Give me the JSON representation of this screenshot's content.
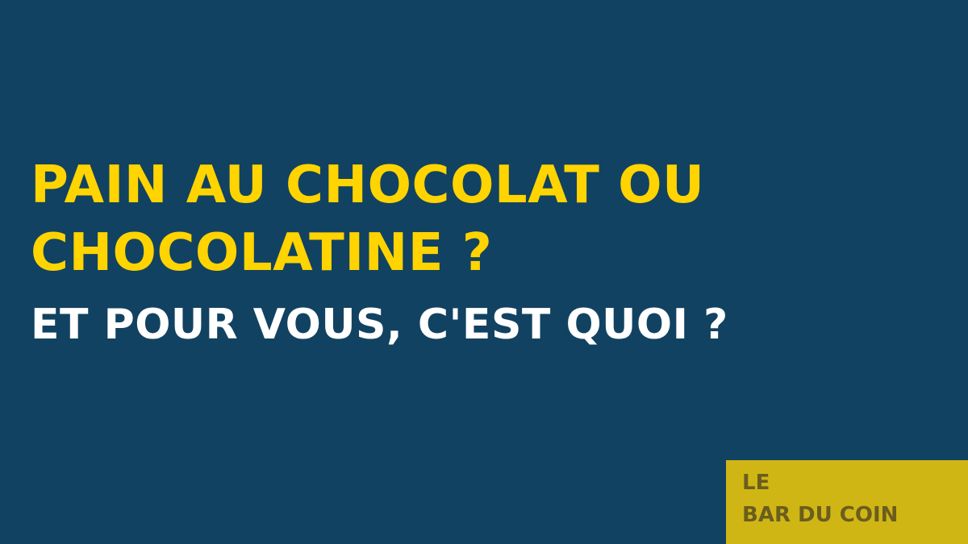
{
  "headline": {
    "line1": "PAIN AU CHOCOLAT OU",
    "line2": "CHOCOLATINE ?"
  },
  "subheadline": "ET POUR VOUS, C'EST QUOI ?",
  "brand": {
    "line1": "LE",
    "line2": "BAR DU COIN"
  },
  "colors": {
    "background": "#124261",
    "headline": "#ffd400",
    "subheadline": "#ffffff",
    "brand_block": "#cfb615",
    "brand_text": "#6b5d1d"
  }
}
